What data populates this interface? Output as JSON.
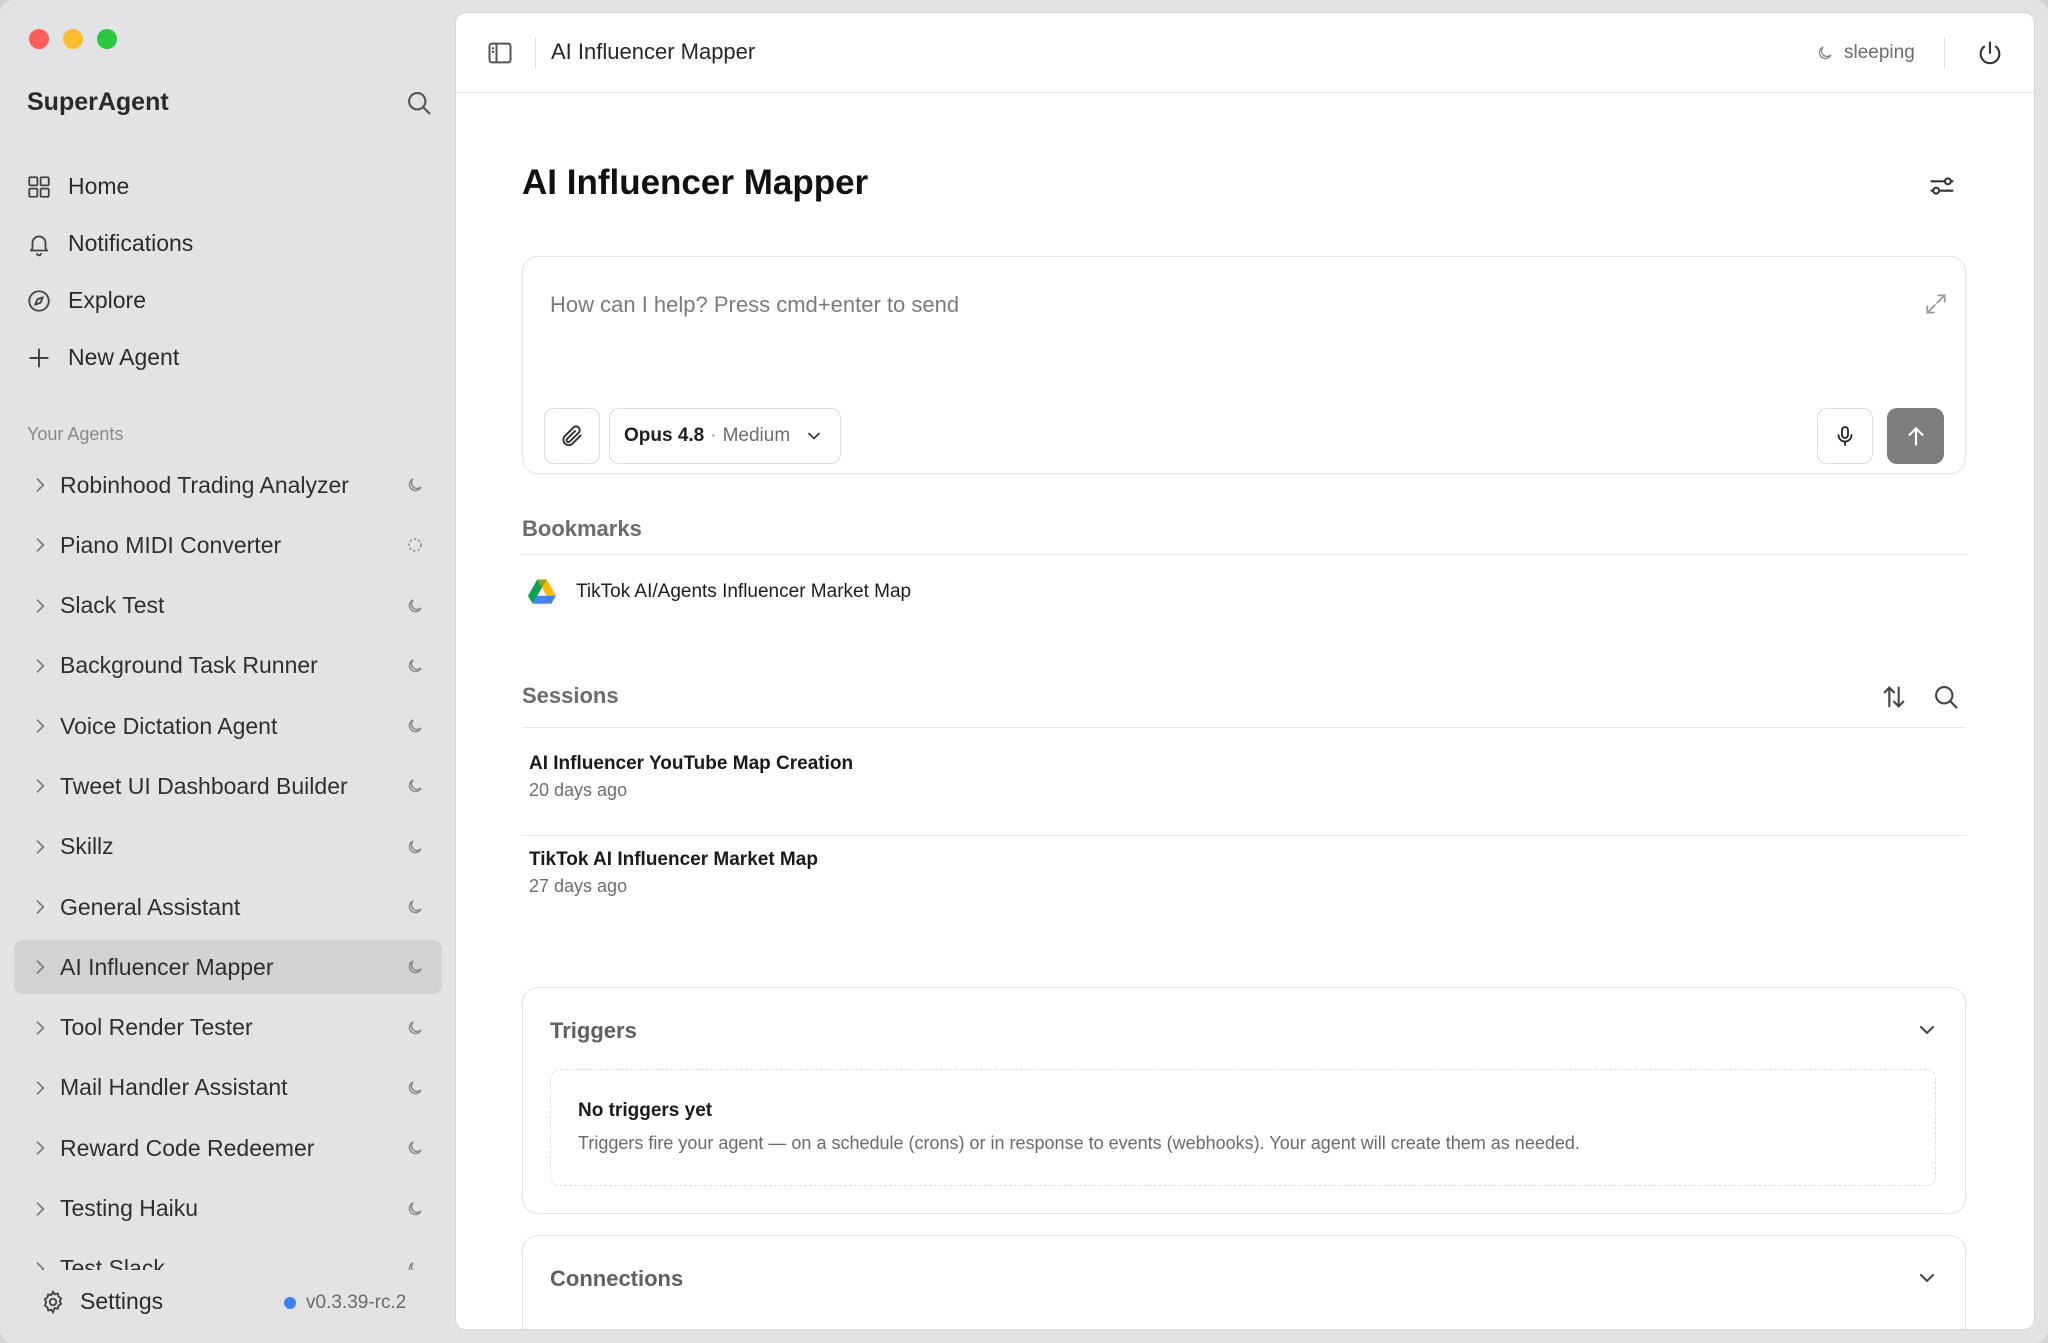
{
  "sidebar": {
    "brand": "SuperAgent",
    "nav": [
      {
        "label": "Home",
        "icon": "grid-icon"
      },
      {
        "label": "Notifications",
        "icon": "bell-icon"
      },
      {
        "label": "Explore",
        "icon": "compass-icon"
      },
      {
        "label": "New Agent",
        "icon": "plus-icon"
      }
    ],
    "section_label": "Your Agents",
    "agents": [
      {
        "name": "Robinhood Trading Analyzer",
        "status": "sleeping"
      },
      {
        "name": "Piano MIDI Converter",
        "status": "loading"
      },
      {
        "name": "Slack Test",
        "status": "sleeping"
      },
      {
        "name": "Background Task Runner",
        "status": "sleeping"
      },
      {
        "name": "Voice Dictation Agent",
        "status": "sleeping"
      },
      {
        "name": "Tweet UI Dashboard Builder",
        "status": "sleeping"
      },
      {
        "name": "Skillz",
        "status": "sleeping"
      },
      {
        "name": "General Assistant",
        "status": "sleeping"
      },
      {
        "name": "AI Influencer Mapper",
        "status": "sleeping",
        "active": true
      },
      {
        "name": "Tool Render Tester",
        "status": "sleeping"
      },
      {
        "name": "Mail Handler Assistant",
        "status": "sleeping"
      },
      {
        "name": "Reward Code Redeemer",
        "status": "sleeping"
      },
      {
        "name": "Testing Haiku",
        "status": "sleeping"
      },
      {
        "name": "Test Slack",
        "status": "sleeping"
      }
    ],
    "settings_label": "Settings",
    "version": "v0.3.39-rc.2",
    "version_dot_color": "#3b82f6"
  },
  "topbar": {
    "title": "AI Influencer Mapper",
    "status": "sleeping"
  },
  "main": {
    "title": "AI Influencer Mapper",
    "composer": {
      "placeholder": "How can I help? Press cmd+enter to send",
      "model": "Opus 4.8",
      "separator": "·",
      "effort": "Medium"
    },
    "bookmarks": {
      "heading": "Bookmarks",
      "items": [
        {
          "label": "TikTok AI/Agents Influencer Market Map",
          "icon": "google-drive-icon"
        }
      ]
    },
    "sessions": {
      "heading": "Sessions",
      "items": [
        {
          "title": "AI Influencer YouTube Map Creation",
          "time": "20 days ago"
        },
        {
          "title": "TikTok AI Influencer Market Map",
          "time": "27 days ago"
        }
      ]
    },
    "triggers": {
      "heading": "Triggers",
      "empty_title": "No triggers yet",
      "empty_desc": "Triggers fire your agent — on a schedule (crons) or in response to events (webhooks). Your agent will create them as needed."
    },
    "connections": {
      "heading": "Connections"
    }
  },
  "colors": {
    "sidebar_bg": "#e3e3e5",
    "active_agent_bg": "#d2d2d5",
    "send_button": "#7d7d80"
  }
}
